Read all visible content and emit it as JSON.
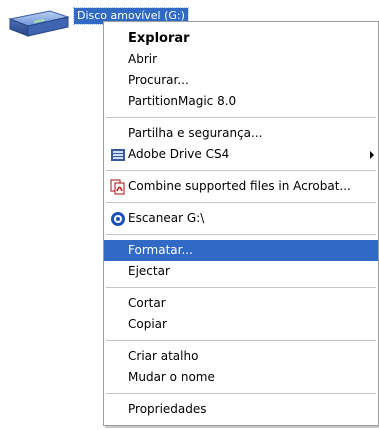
{
  "desktop": {
    "drive_label": "Disco amovível (G:)",
    "drive_icon": "removable-disk-icon"
  },
  "context_menu": {
    "colors": {
      "highlight_bg": "#316ac5",
      "highlight_text": "#ffffff",
      "separator": "#c5c5c5"
    },
    "groups": [
      [
        {
          "label": "Explorar",
          "bold": true
        },
        {
          "label": "Abrir"
        },
        {
          "label": "Procurar..."
        },
        {
          "label": "PartitionMagic 8.0"
        }
      ],
      [
        {
          "label": "Partilha e segurança..."
        },
        {
          "label": "Adobe Drive CS4",
          "icon": "adobe-drive-icon",
          "submenu": true
        }
      ],
      [
        {
          "label": "Combine supported files in Acrobat...",
          "icon": "acrobat-combine-icon"
        }
      ],
      [
        {
          "label": "Escanear G:\\",
          "icon": "antivirus-scan-icon"
        }
      ],
      [
        {
          "label": "Formatar...",
          "highlighted": true
        },
        {
          "label": "Ejectar"
        }
      ],
      [
        {
          "label": "Cortar"
        },
        {
          "label": "Copiar"
        }
      ],
      [
        {
          "label": "Criar atalho"
        },
        {
          "label": "Mudar o nome"
        }
      ],
      [
        {
          "label": "Propriedades"
        }
      ]
    ]
  }
}
